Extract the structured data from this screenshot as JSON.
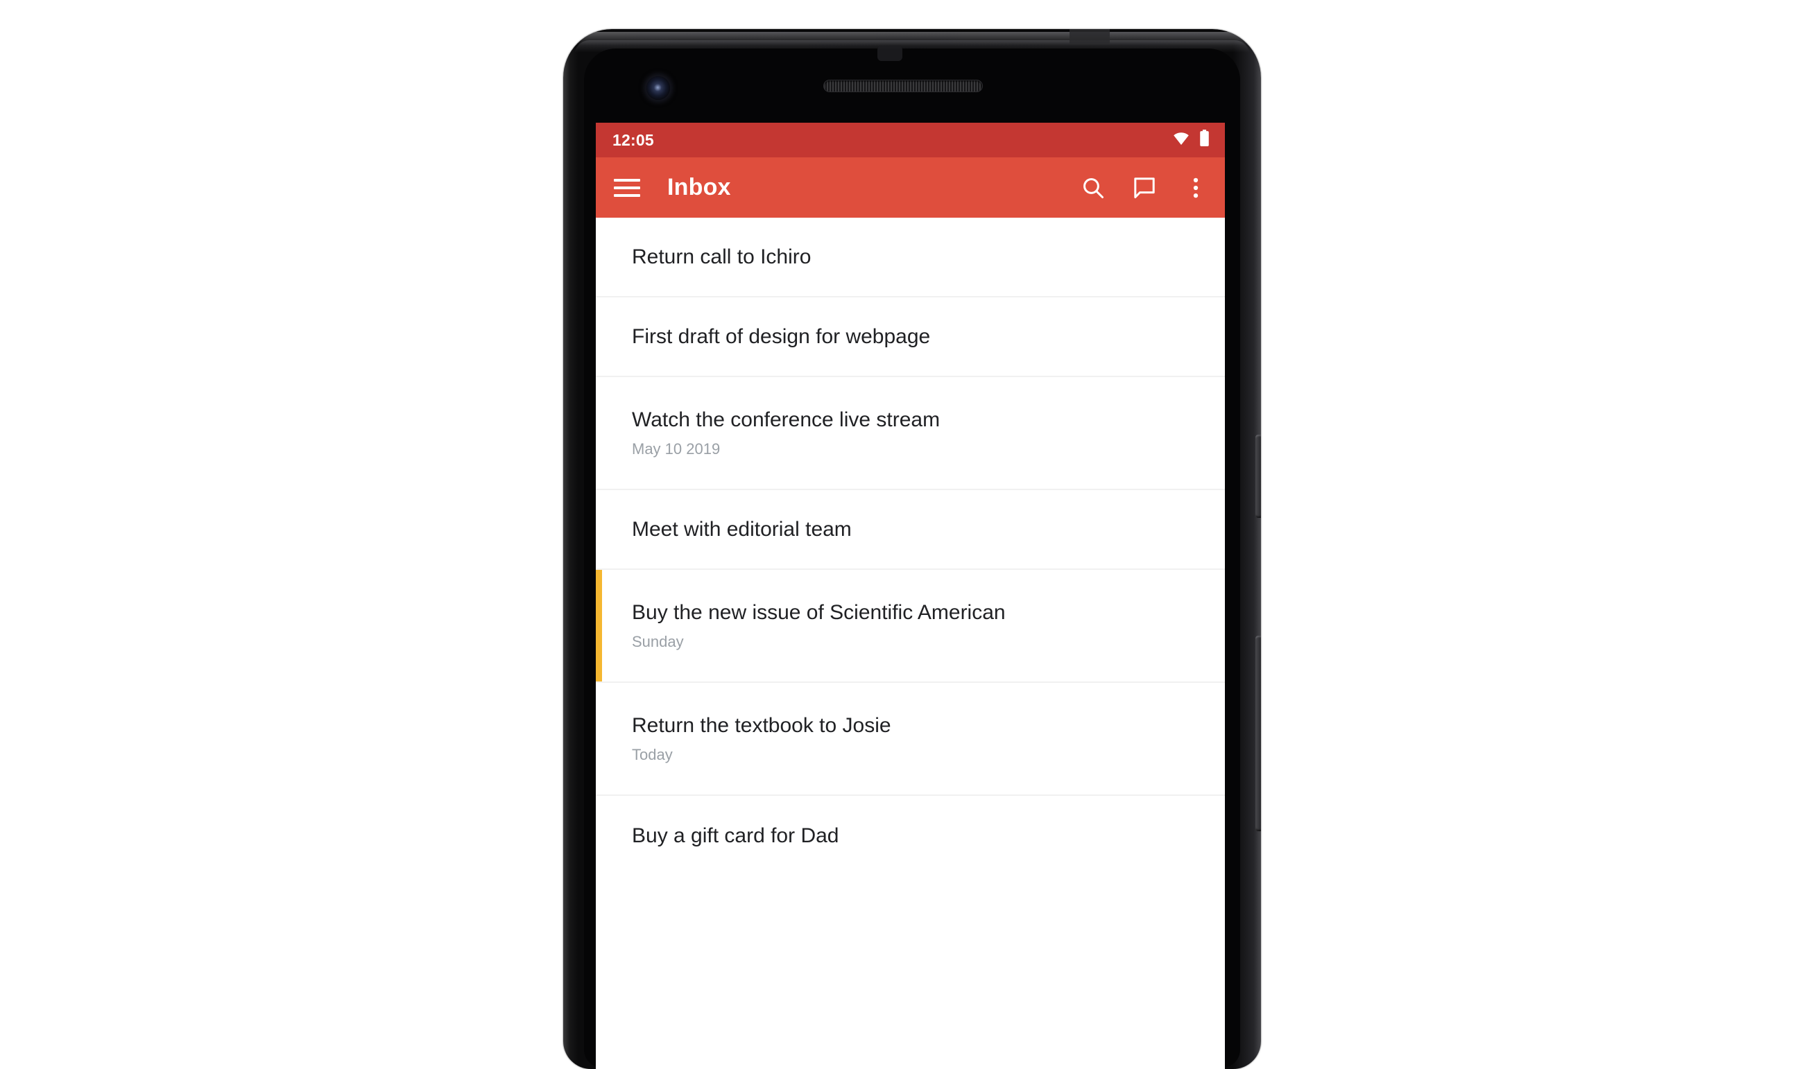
{
  "status_bar": {
    "time": "12:05",
    "icons": [
      "wifi-icon",
      "battery-icon"
    ],
    "background": "#c43732"
  },
  "app_bar": {
    "menu_icon": "hamburger-menu-icon",
    "title": "Inbox",
    "actions": [
      {
        "name": "search-icon",
        "label": "Search"
      },
      {
        "name": "chat-bubble-icon",
        "label": "Chat"
      },
      {
        "name": "overflow-menu-icon",
        "label": "More options"
      }
    ],
    "background": "#df4e3d"
  },
  "task_list": {
    "accent_color": "#f5b731",
    "items": [
      {
        "title": "Return call to Ichiro",
        "subtitle": "",
        "accent": false
      },
      {
        "title": "First draft of design for webpage",
        "subtitle": "",
        "accent": false
      },
      {
        "title": "Watch the conference live stream",
        "subtitle": "May 10 2019",
        "accent": false
      },
      {
        "title": "Meet with editorial team",
        "subtitle": "",
        "accent": false
      },
      {
        "title": "Buy the new issue of Scientific American",
        "subtitle": "Sunday",
        "accent": true
      },
      {
        "title": "Return the textbook to Josie",
        "subtitle": "Today",
        "accent": false
      },
      {
        "title": "Buy a gift card for Dad",
        "subtitle": "",
        "accent": false
      }
    ]
  },
  "device": {
    "name": "smartphone-mockup",
    "buttons": [
      "power-button",
      "volume-rocker"
    ],
    "features": [
      "front-camera",
      "earpiece-speaker",
      "proximity-sensor",
      "antenna-band"
    ]
  }
}
